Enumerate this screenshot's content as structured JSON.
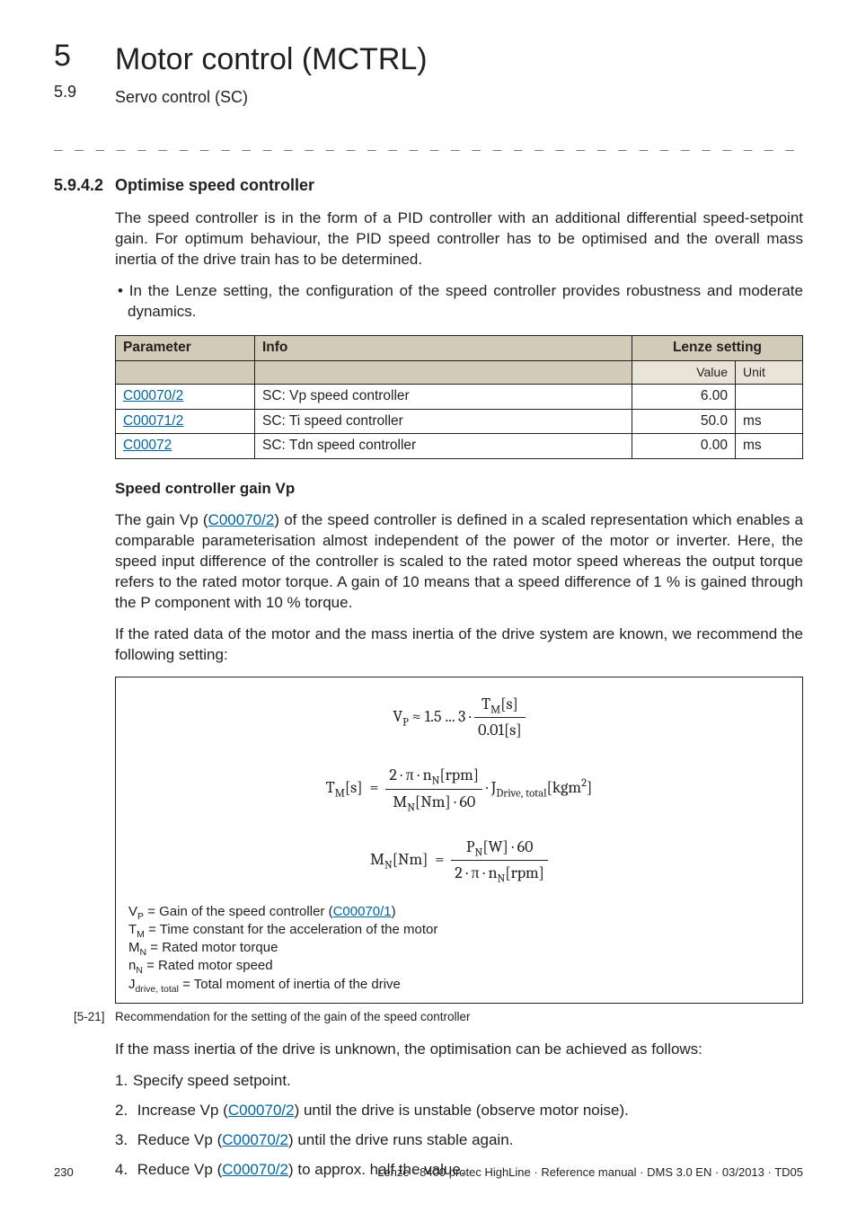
{
  "header": {
    "chapnum": "5",
    "chapter_title": "Motor control (MCTRL)",
    "subnum": "5.9",
    "subtitle": "Servo control (SC)"
  },
  "section": {
    "num": "5.9.4.2",
    "title": "Optimise speed controller",
    "intro": "The speed controller is in the form of a PID controller with an additional differential speed-setpoint gain. For optimum behaviour, the PID speed controller has to be optimised and the overall mass inertia of the drive train has to be determined.",
    "bullet": "In the Lenze setting, the configuration of the speed controller provides robustness and moderate dynamics."
  },
  "table": {
    "h_param": "Parameter",
    "h_info": "Info",
    "h_lenze": "Lenze setting",
    "h_value": "Value",
    "h_unit": "Unit",
    "rows": [
      {
        "param": "C00070/2",
        "info": "SC: Vp speed controller",
        "value": "6.00",
        "unit": ""
      },
      {
        "param": "C00071/2",
        "info": "SC: Ti speed controller",
        "value": "50.0",
        "unit": "ms"
      },
      {
        "param": "C00072",
        "info": "SC: Tdn speed controller",
        "value": "0.00",
        "unit": "ms"
      }
    ]
  },
  "gain": {
    "heading": "Speed controller gain Vp",
    "p1a": "The gain Vp (",
    "p1link": "C00070/2",
    "p1b": ") of the speed controller is defined in a scaled representation which enables a comparable parameterisation almost independent of the power of the motor or inverter. Here, the speed input difference of the controller is scaled to the rated motor speed whereas the output torque refers to the rated motor torque. A gain of 10 means that a speed difference of 1 % is gained through the P component with 10 % torque.",
    "p2": "If the rated data of the motor and the mass inertia of the drive system are known, we recommend the following setting:"
  },
  "legend": {
    "l1a": "V",
    "l1sub": "P",
    "l1b": " = Gain of the speed controller (",
    "l1link": "C00070/1",
    "l1c": ")",
    "l2a": "T",
    "l2sub": "M",
    "l2b": " = Time constant for the acceleration of the motor",
    "l3a": "M",
    "l3sub": "N",
    "l3b": " = Rated motor torque",
    "l4a": "n",
    "l4sub": "N",
    "l4b": " = Rated motor speed",
    "l5a": "J",
    "l5sub": "drive, total",
    "l5b": " = Total moment of inertia of the drive"
  },
  "caption": {
    "label": "[5-21]",
    "text": "Recommendation for the setting of the gain of the speed controller"
  },
  "after_box": "If the mass inertia of the drive is unknown, the optimisation can be achieved as follows:",
  "steps": {
    "s1": "Specify speed setpoint.",
    "s2a": "Increase Vp (",
    "s2link": "C00070/2",
    "s2b": ") until the drive is unstable (observe motor noise).",
    "s3a": "Reduce Vp (",
    "s3link": "C00070/2",
    "s3b": ") until the drive runs stable again.",
    "s4a": "Reduce Vp (",
    "s4link": "C00070/2",
    "s4b": ") to approx. half the value."
  },
  "footer": {
    "page": "230",
    "right": "Lenze · 8400 protec HighLine · Reference manual · DMS 3.0 EN · 03/2013 · TD05"
  }
}
